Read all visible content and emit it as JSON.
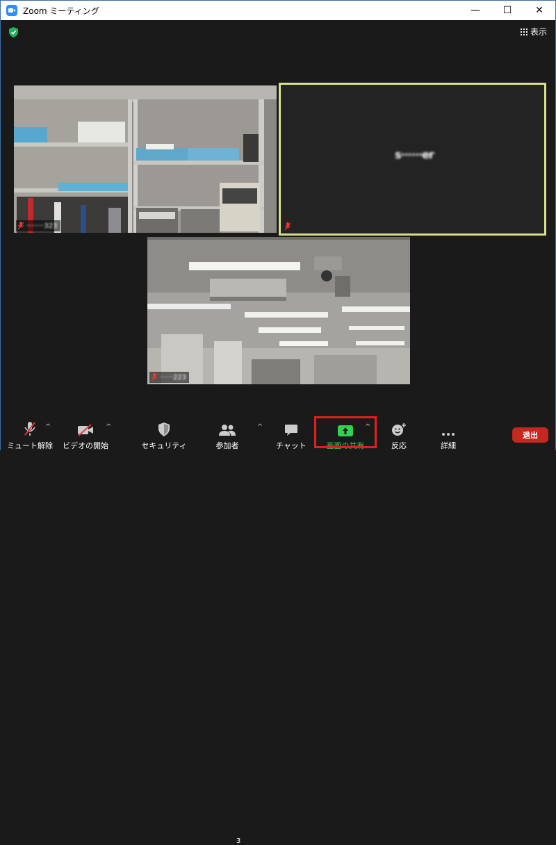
{
  "window": {
    "title": "Zoom ミーティング",
    "controls": {
      "minimize": "—",
      "maximize": "☐",
      "close": "✕"
    }
  },
  "top": {
    "view_label": "表示"
  },
  "participants": [
    {
      "name": "········323",
      "muted": true
    },
    {
      "name": "s······er",
      "muted": true,
      "active_speaker": true
    },
    {
      "name": "······223",
      "muted": true
    }
  ],
  "toolbar": {
    "mute": "ミュート解除",
    "video": "ビデオの開始",
    "security": "セキュリティ",
    "participants": "参加者",
    "participants_count": "3",
    "chat": "チャット",
    "share": "画面の共有",
    "reactions": "反応",
    "more": "詳細",
    "leave": "退出"
  },
  "colors": {
    "background": "#1a1a1a",
    "active_border": "#d8e08a",
    "share_green": "#30d34e",
    "leave_red": "#c4281e",
    "highlight_red": "#e02020",
    "shield_green": "#1fb35b"
  }
}
